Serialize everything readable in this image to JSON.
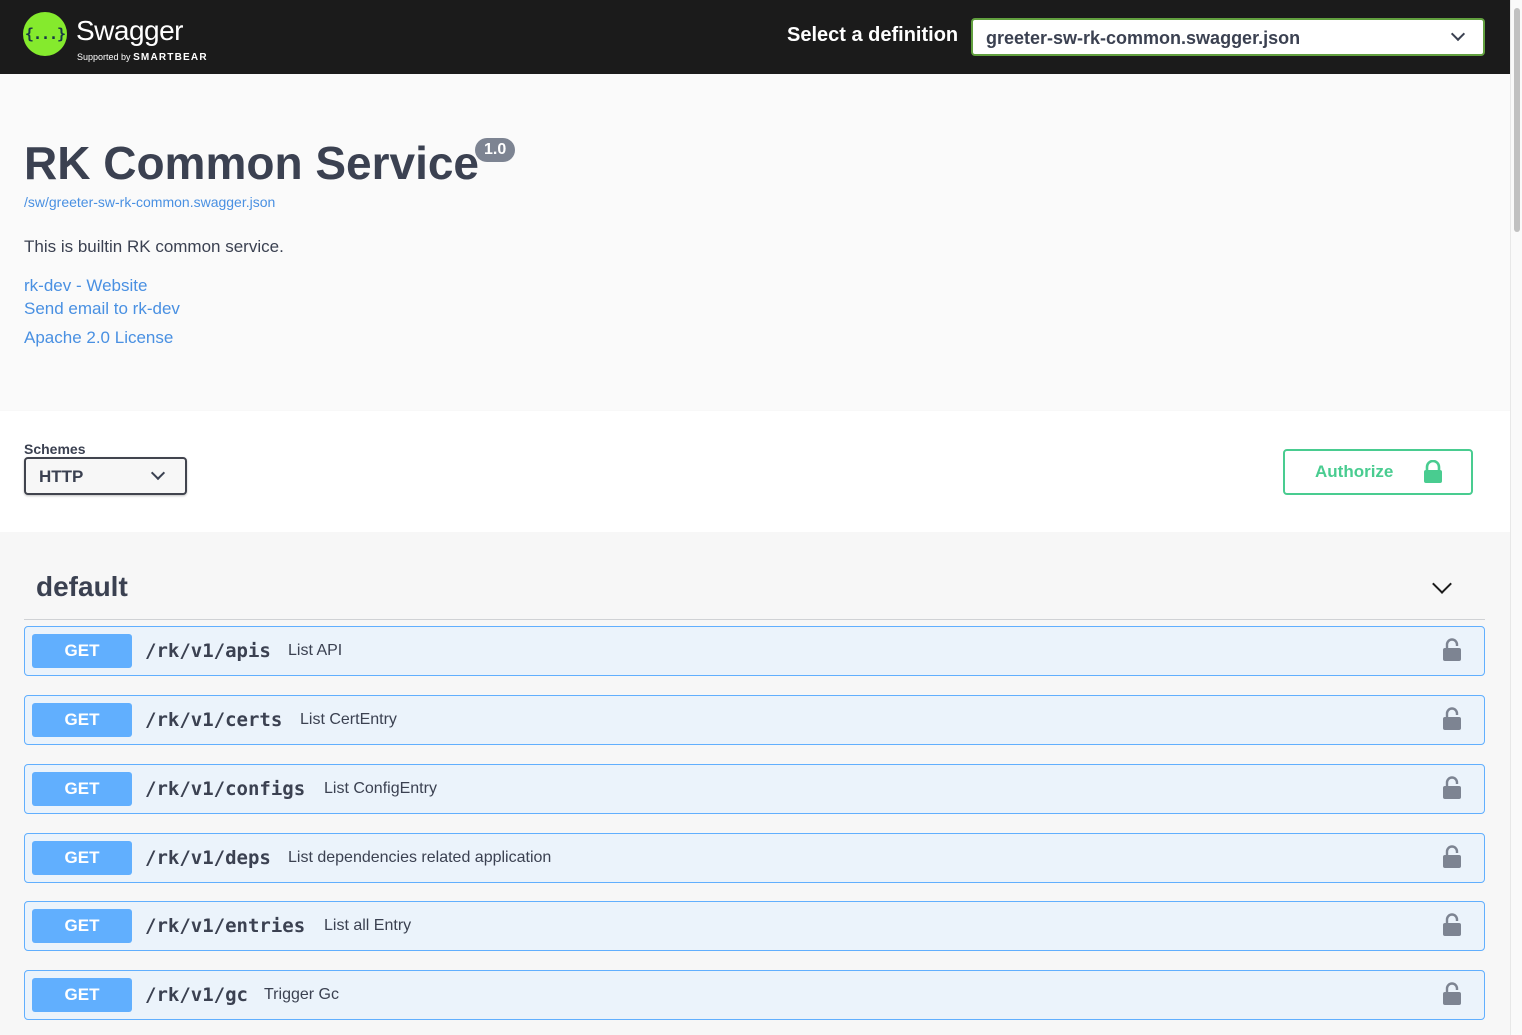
{
  "topbar": {
    "logo_word": "Swagger",
    "logo_supported": "Supported by",
    "logo_brand": "SMARTBEAR",
    "logo_glyph": "{...}",
    "definition_label": "Select a definition",
    "definition_value": "greeter-sw-rk-common.swagger.json"
  },
  "info": {
    "title": "RK Common Service",
    "version": "1.0",
    "url": "/sw/greeter-sw-rk-common.swagger.json",
    "description": "This is builtin RK common service.",
    "website_link": "rk-dev - Website",
    "email_link": "Send email to rk-dev",
    "license_link": "Apache 2.0 License"
  },
  "schemes": {
    "label": "Schemes",
    "value": "HTTP",
    "authorize_label": "Authorize"
  },
  "tag": {
    "name": "default"
  },
  "operations": [
    {
      "method": "GET",
      "path": "/rk/v1/apis",
      "summary": "List API"
    },
    {
      "method": "GET",
      "path": "/rk/v1/certs",
      "summary": "List CertEntry"
    },
    {
      "method": "GET",
      "path": "/rk/v1/configs",
      "summary": "List ConfigEntry"
    },
    {
      "method": "GET",
      "path": "/rk/v1/deps",
      "summary": "List dependencies related application"
    },
    {
      "method": "GET",
      "path": "/rk/v1/entries",
      "summary": "List all Entry"
    },
    {
      "method": "GET",
      "path": "/rk/v1/gc",
      "summary": "Trigger Gc"
    }
  ],
  "colors": {
    "topbar": "#1b1b1b",
    "logo_green": "#85ea2d",
    "get_blue": "#61affe",
    "authorize_green": "#49cc90",
    "link_blue": "#4990e2"
  }
}
